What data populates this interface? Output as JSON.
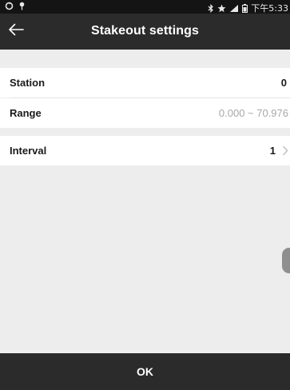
{
  "status_bar": {
    "left_icons": [
      "sync-icon",
      "location-pin-icon"
    ],
    "right_icons": [
      "bluetooth-icon",
      "star-icon",
      "signal-icon",
      "battery-icon"
    ],
    "time": "下午5:33"
  },
  "header": {
    "back_icon": "arrow-left-icon",
    "title": "Stakeout settings"
  },
  "settings": {
    "station": {
      "label": "Station",
      "value": "0"
    },
    "range": {
      "label": "Range",
      "value": "0.000 ~ 70.976"
    },
    "interval": {
      "label": "Interval",
      "value": "1",
      "chevron_icon": "chevron-right-icon"
    }
  },
  "footer": {
    "ok_label": "OK"
  },
  "colors": {
    "bar_background": "#2b2b2b",
    "page_background": "#ededed",
    "row_background": "#ffffff",
    "muted_text": "#a8a8a8"
  }
}
